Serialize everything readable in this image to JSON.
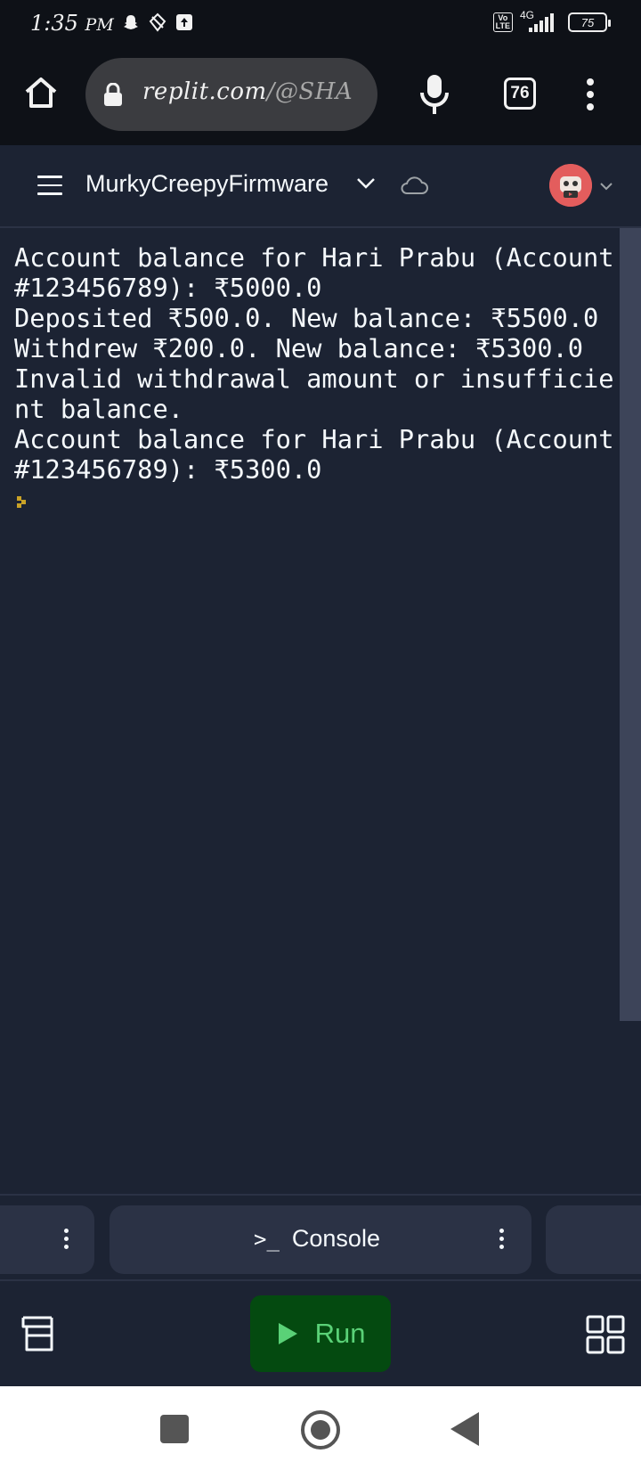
{
  "status_bar": {
    "time": "1:35",
    "ampm": "PM",
    "network": "4G",
    "volte": "Vo\nLTE",
    "battery": "75"
  },
  "browser": {
    "url_host": "replit.com",
    "url_path": "/@SHA",
    "tab_count": "76"
  },
  "header": {
    "repl_name": "MurkyCreepyFirmware"
  },
  "console": {
    "output": "Account balance for Hari Prabu (Account #123456789): ₹5000.0\nDeposited ₹500.0. New balance: ₹5500.0\nWithdrew ₹200.0. New balance: ₹5300.0\nInvalid withdrawal amount or insufficient balance.\nAccount balance for Hari Prabu (Account #123456789): ₹5300.0"
  },
  "panel_tabs": {
    "console_label": "Console",
    "console_glyph": ">_"
  },
  "toolbar": {
    "run_label": "Run"
  },
  "colors": {
    "background": "#1c2333",
    "run_button_bg": "#044a10",
    "run_button_text": "#5ad177",
    "avatar": "#e35d5d",
    "cursor": "#c9a227"
  }
}
